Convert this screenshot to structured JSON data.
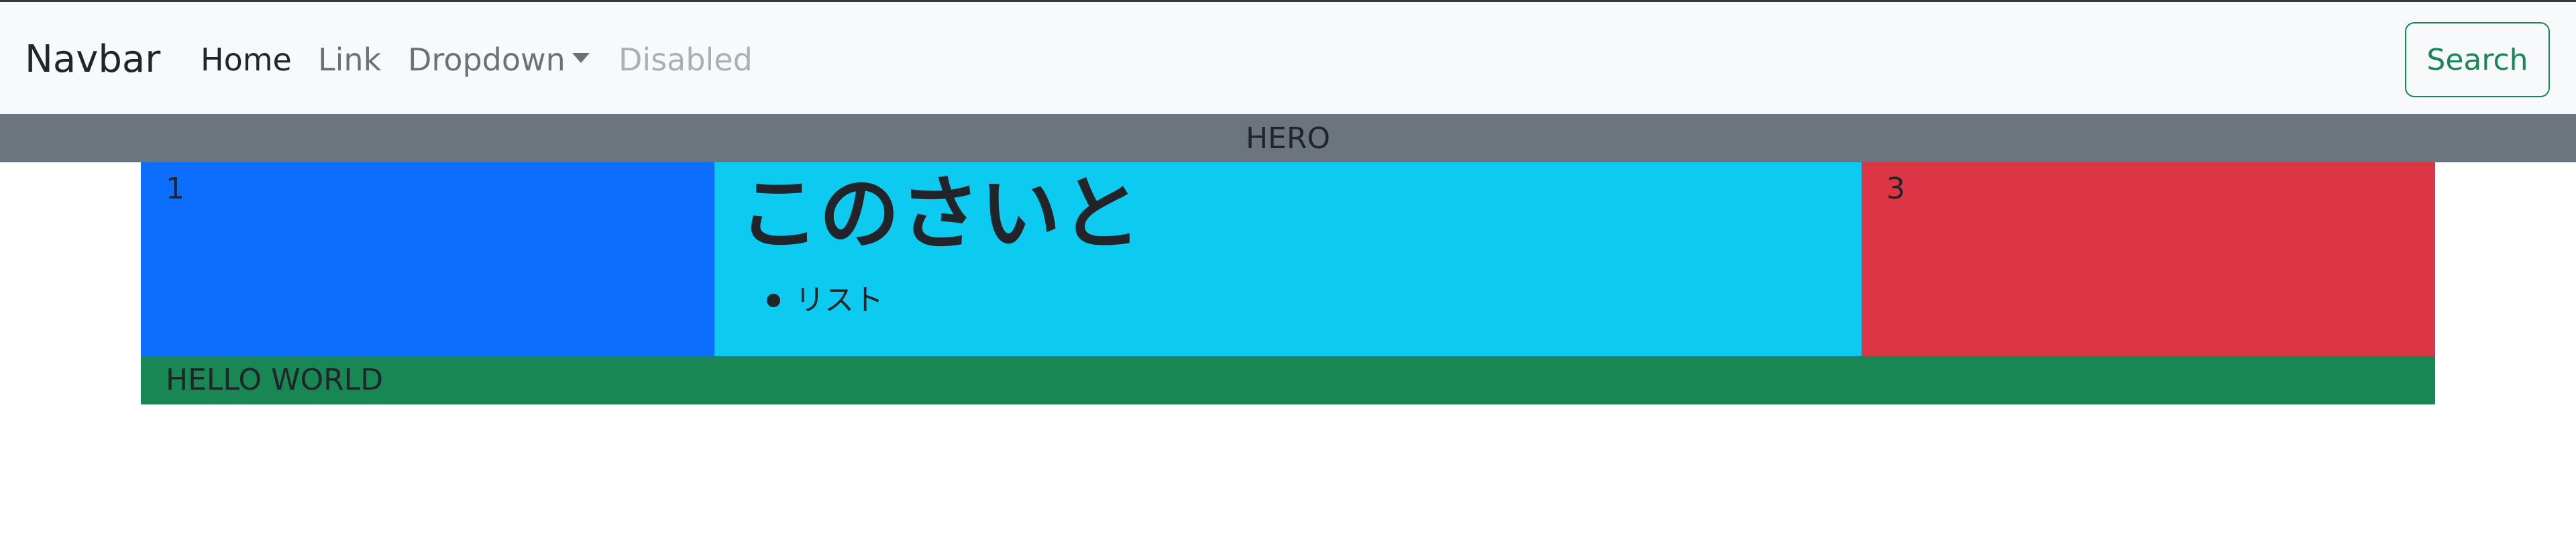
{
  "navbar": {
    "brand": "Navbar",
    "links": [
      {
        "label": "Home",
        "state": "active"
      },
      {
        "label": "Link",
        "state": "normal"
      },
      {
        "label": "Dropdown",
        "state": "normal"
      },
      {
        "label": "Disabled",
        "state": "disabled"
      }
    ],
    "search_button": "Search"
  },
  "hero": {
    "label": "HERO"
  },
  "columns": {
    "col1": {
      "label": "1"
    },
    "col2": {
      "heading": "このさいと",
      "list_items": [
        "リスト"
      ]
    },
    "col3": {
      "label": "3"
    }
  },
  "footer_bar": {
    "label": "HELLO WORLD"
  },
  "colors": {
    "navbar_bg": "#f8f9fa",
    "hero_bg": "#6c757d",
    "col1_bg": "#0d6efd",
    "col2_bg": "#0dcaf0",
    "col3_bg": "#dc3545",
    "footer_bg": "#198754",
    "search_button": "#198754"
  },
  "icons": {
    "dropdown_caret": "caret-down-icon"
  }
}
